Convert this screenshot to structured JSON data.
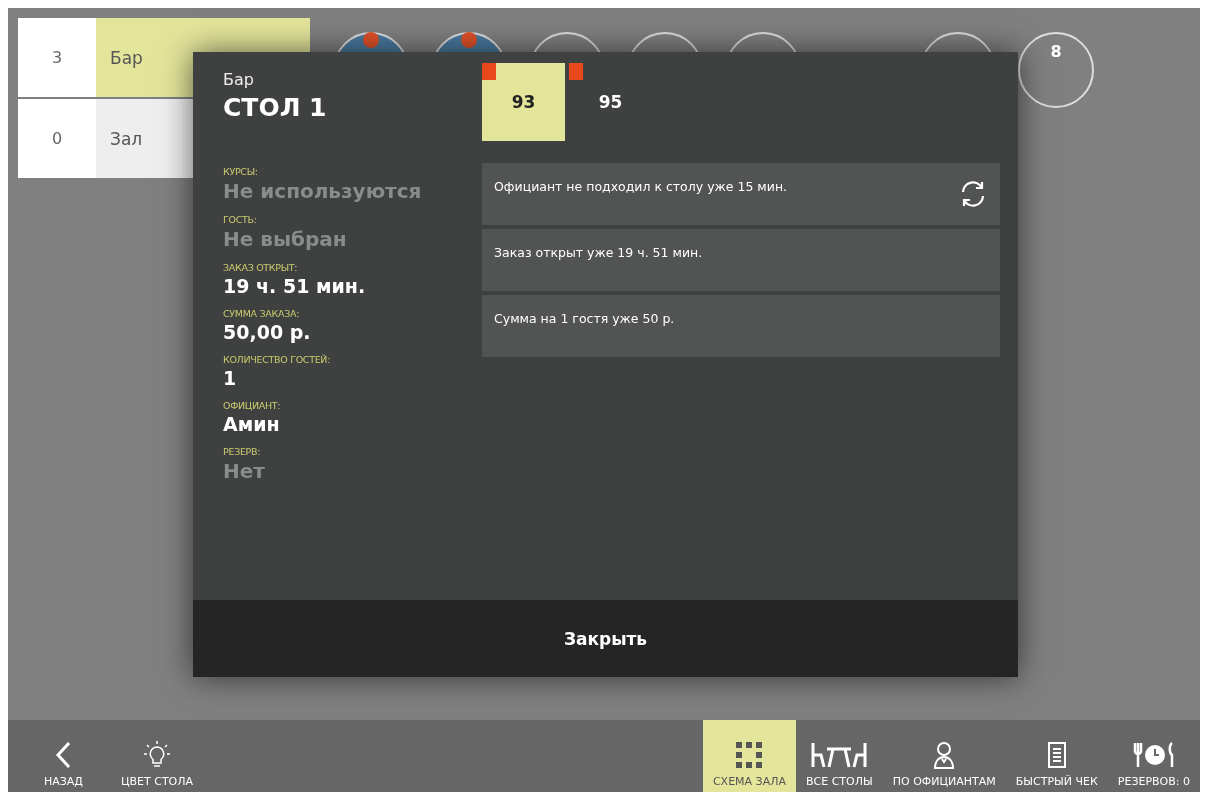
{
  "halls": [
    {
      "count": "3",
      "name": "Бар",
      "selected": true
    },
    {
      "count": "0",
      "name": "Зал",
      "selected": false
    }
  ],
  "tables": [
    {
      "alert": true,
      "color": "#4a7ba0"
    },
    {
      "alert": true,
      "color": "#4a7ba0"
    },
    {
      "alert": false,
      "color": "#808080"
    },
    {
      "alert": false,
      "color": "#808080"
    },
    {
      "alert": false,
      "color": "#808080"
    },
    {
      "alert": false,
      "color": "#808080"
    },
    {
      "label": "8",
      "alert": false,
      "color": "#808080"
    }
  ],
  "dialog": {
    "hall": "Бар",
    "title": "СТОЛ 1",
    "fields": [
      {
        "label": "КУРСЫ:",
        "value": "Не используются",
        "muted": true
      },
      {
        "label": "ГОСТЬ:",
        "value": "Не выбран",
        "muted": true
      },
      {
        "label": "ЗАКАЗ ОТКРЫТ:",
        "value": "19 ч. 51 мин.",
        "muted": false
      },
      {
        "label": "СУММА ЗАКАЗА:",
        "value": "50,00 р.",
        "muted": false
      },
      {
        "label": "КОЛИЧЕСТВО ГОСТЕЙ:",
        "value": "1",
        "muted": false
      },
      {
        "label": "ОФИЦИАНТ:",
        "value": "Амин",
        "muted": false
      },
      {
        "label": "РЕЗЕРВ:",
        "value": "Нет",
        "muted": true
      }
    ],
    "orders": [
      {
        "number": "93",
        "selected": true,
        "alert": true
      },
      {
        "number": "95",
        "selected": false,
        "alert": true
      }
    ],
    "alerts": [
      {
        "text": "Официант не подходил к столу уже 15 мин.",
        "refresh": true
      },
      {
        "text": "Заказ открыт уже 19 ч. 51 мин.",
        "refresh": false
      },
      {
        "text": "Сумма на 1 гостя уже 50 р.",
        "refresh": false
      }
    ],
    "close": "Закрыть"
  },
  "toolbar": [
    {
      "kind": "back",
      "label": "НАЗАД",
      "selected": false
    },
    {
      "kind": "bulb",
      "label": "ЦВЕТ СТОЛА",
      "selected": false
    },
    {
      "kind": "spacer"
    },
    {
      "kind": "grid",
      "label": "СХЕМА ЗАЛА",
      "selected": true
    },
    {
      "kind": "tables",
      "label": "ВСЕ СТОЛЫ",
      "selected": false
    },
    {
      "kind": "waiter",
      "label": "ПО ОФИЦИАНТАМ",
      "selected": false
    },
    {
      "kind": "receipt",
      "label": "БЫСТРЫЙ ЧЕК",
      "selected": false
    },
    {
      "kind": "reserve",
      "label": "РЕЗЕРВОВ: 0",
      "selected": false
    }
  ]
}
